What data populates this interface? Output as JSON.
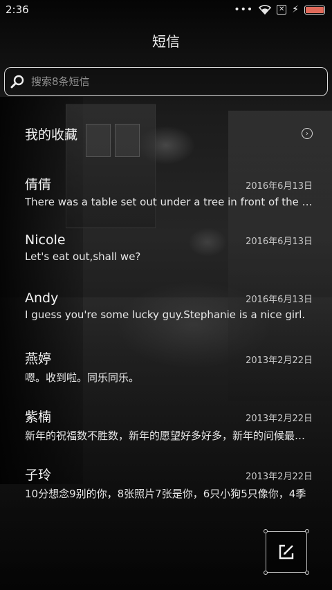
{
  "status_bar": {
    "time": "2:36",
    "dots": "•••",
    "sim_icon": "sim-off-icon",
    "bolt": "⚡"
  },
  "header": {
    "title": "短信"
  },
  "search": {
    "placeholder": "搜索8条短信",
    "value": ""
  },
  "favorites": {
    "label": "我的收藏",
    "arrow": "›"
  },
  "messages": [
    {
      "name": "倩倩",
      "date": "2016年6月13日",
      "preview": "There was a table set out under a tree in front of the house"
    },
    {
      "name": "Nicole",
      "date": "2016年6月13日",
      "preview": "Let's eat out,shall we?"
    },
    {
      "name": "Andy",
      "date": "2016年6月13日",
      "preview": "I guess you're some lucky guy.Stephanie is a nice girl."
    },
    {
      "name": "燕婷",
      "date": "2013年2月22日",
      "preview": "嗯。收到啦。同乐同乐。"
    },
    {
      "name": "紫楠",
      "date": "2013年2月22日",
      "preview": "新年的祝福数不胜数，新年的愿望好多好多，新年的问候最多最多"
    },
    {
      "name": "子玲",
      "date": "2013年2月22日",
      "preview": "10分想念9别的你，8张照片7张是你，6只小狗5只像你，4季"
    }
  ],
  "colors": {
    "battery": "#e06a5a",
    "text": "#e9e9e9",
    "border": "#dcdcdc"
  }
}
